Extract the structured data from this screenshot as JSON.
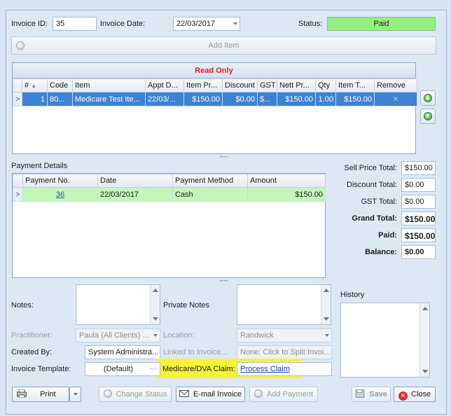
{
  "header": {
    "invoice_id_label": "Invoice ID:",
    "invoice_id_value": "35",
    "invoice_date_label": "Invoice Date:",
    "invoice_date_value": "22/03/2017",
    "status_label": "Status:",
    "status_value": "Paid"
  },
  "add_item_label": "Add Item",
  "items_grid": {
    "banner": "Read Only",
    "columns": [
      "#",
      "Code",
      "Item",
      "Appt D...",
      "Item Pr...",
      "Discount",
      "GST",
      "Nett Pr...",
      "Qty",
      "Item T...",
      "Remove"
    ],
    "row": [
      "1",
      "80...",
      "Medicare Test Ite...",
      "22/03/...",
      "$150.00",
      "$0.00",
      "$...",
      "$150.00",
      "1.00",
      "$150.00",
      "✕"
    ]
  },
  "payment_section": {
    "title": "Payment Details",
    "columns": [
      "Payment No.",
      "Date",
      "Payment Method",
      "Amount"
    ],
    "row": [
      "36",
      "22/03/2017",
      "Cash",
      "$150.00"
    ]
  },
  "totals": {
    "sell_price_label": "Sell Price Total:",
    "sell_price_value": "$150.00",
    "discount_label": "Discount Total:",
    "discount_value": "$0.00",
    "gst_label": "GST Total:",
    "gst_value": "$0.00",
    "grand_label": "Grand Total:",
    "grand_value": "$150.00",
    "paid_label": "Paid:",
    "paid_value": "$150.00",
    "balance_label": "Balance:",
    "balance_value": "$0.00"
  },
  "details": {
    "notes_label": "Notes:",
    "private_notes_label": "Private Notes",
    "history_label": "History",
    "practitioner_label": "Practitioner:",
    "practitioner_value": "Paula (All Clients) ...",
    "location_label": "Location:",
    "location_value": "Randwick",
    "created_by_label": "Created By:",
    "created_by_value": "System Administra...",
    "linked_label": "Linked to Invoice...",
    "linked_value": "None: Click to Split Invoi...",
    "template_label": "Invoice Template:",
    "template_value": "(Default)",
    "template_ellipsis": "···",
    "medicare_label": "Medicare/DVA Claim:",
    "medicare_value": "Process Claim"
  },
  "buttons": {
    "print": "Print",
    "change_status": "Change Status",
    "email_invoice": "E-mail Invoice",
    "add_payment": "Add Payment",
    "save": "Save",
    "close": "Close"
  },
  "colors": {
    "status_paid": "#94f07f",
    "read_only_text": "#e0201b",
    "selected_row": "#3d82d3",
    "payment_row": "#c2f7b8",
    "highlight": "#f7f33a"
  }
}
